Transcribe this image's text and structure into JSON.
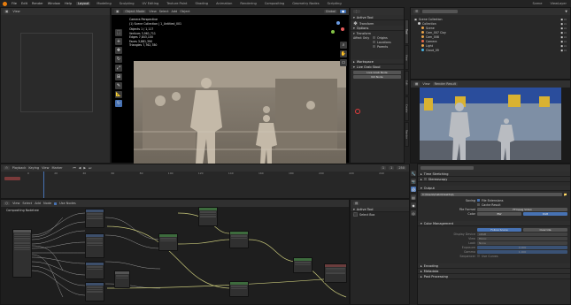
{
  "menu": {
    "items": [
      "File",
      "Edit",
      "Render",
      "Window",
      "Help"
    ],
    "workspaces": [
      "Layout",
      "Modeling",
      "Sculpting",
      "UV Editing",
      "Texture Paint",
      "Shading",
      "Animation",
      "Rendering",
      "Compositing",
      "Geometry Nodes",
      "Scripting"
    ],
    "active_workspace": "Layout",
    "scene": "Scene",
    "view_layer": "ViewLayer"
  },
  "viewport": {
    "mode": "Object Mode",
    "menus": [
      "View",
      "Select",
      "Add",
      "Object"
    ],
    "transform": "Global",
    "camera_title": "Camera Perspective",
    "collection": "(1) Scene Collection | 1_Untitled_001",
    "stats": [
      {
        "label": "Objects",
        "value": "1 / 1,117"
      },
      {
        "label": "Vertices",
        "value": "3,961,711"
      },
      {
        "label": "Edges",
        "value": "7,843,100"
      },
      {
        "label": "Faces",
        "value": "3,881,390"
      },
      {
        "label": "Triangles",
        "value": "7,762,780"
      }
    ]
  },
  "npanel": {
    "active_tool": "Active Tool",
    "tool_name": "Transform",
    "options": "Options",
    "transform": "Transform",
    "affect_only": "Affect Only",
    "origins": "Origins",
    "locations": "Locations",
    "parents": "Parents",
    "workspace": "Workspace",
    "live_grab": "Live Grab Stool",
    "btn1": "Live Grab Node",
    "btn2": "Kill Node",
    "tabs": [
      "Tool",
      "View",
      "Edit",
      "Create",
      "Render",
      "Node Wrangler"
    ]
  },
  "outliner": {
    "title": "Scene Collection",
    "items": [
      {
        "name": "Collection",
        "color": "#cccccc"
      },
      {
        "name": "Scene",
        "color": "#e8a24a"
      },
      {
        "name": "Cam_007 Clay",
        "color": "#e8a24a"
      },
      {
        "name": "Cam_008",
        "color": "#e8a24a"
      },
      {
        "name": "Camera",
        "color": "#e86a4a"
      },
      {
        "name": "Light",
        "color": "#e8a24a"
      },
      {
        "name": "Cloud_09",
        "color": "#4ab8e8"
      }
    ]
  },
  "render_view": {
    "title": "Image Editor",
    "slot": "Render Result",
    "view": "View"
  },
  "timeline": {
    "playback": "Playback",
    "keying": "Keying",
    "view": "View",
    "marker": "Marker",
    "start": "1",
    "end": "250",
    "frame": "1",
    "ticks": [
      "0",
      "20",
      "40",
      "60",
      "80",
      "100",
      "120",
      "140",
      "160",
      "180",
      "200",
      "220",
      "240"
    ]
  },
  "node_editor": {
    "title": "Compositing Nodetree",
    "use_nodes": "Use Nodes",
    "menus": [
      "View",
      "Select",
      "Add",
      "Node"
    ]
  },
  "file_browser": {
    "title": "Active Tool",
    "item": "Select Box"
  },
  "properties": {
    "sections": {
      "time_stretching": "Time Stretching",
      "stereoscopy": "Stereoscopy",
      "output": "Output",
      "color_management": "Color Management",
      "encoding": "Encoding",
      "metadata": "Metadata",
      "post_processing": "Post Processing"
    },
    "output_path": "C:\\Users\\mato\\Desktop\\",
    "saving_label": "Saving",
    "file_extensions": "File Extensions",
    "cache_result": "Cache Result",
    "file_format_label": "File Format",
    "file_format_value": "FFmpeg Video",
    "color_label": "Color",
    "color_options": [
      "BW",
      "RGB"
    ],
    "cm_tabs": [
      "Follow Scene",
      "Override"
    ],
    "cm_rows": [
      {
        "label": "Display Device",
        "value": "sRGB"
      },
      {
        "label": "View",
        "value": "Filmic"
      },
      {
        "label": "Look",
        "value": "None"
      },
      {
        "label": "Exposure",
        "value": "0.000"
      },
      {
        "label": "Gamma",
        "value": "1.000"
      }
    ],
    "sequencer_label": "Sequencer",
    "use_curves": "Use Curves"
  },
  "colors": {
    "accent": "#4772b3",
    "header": "#303030",
    "panel": "#282828",
    "background": "#1d1d1d",
    "frame_marker": "#4772b3",
    "node_link": "#c7c77a"
  }
}
